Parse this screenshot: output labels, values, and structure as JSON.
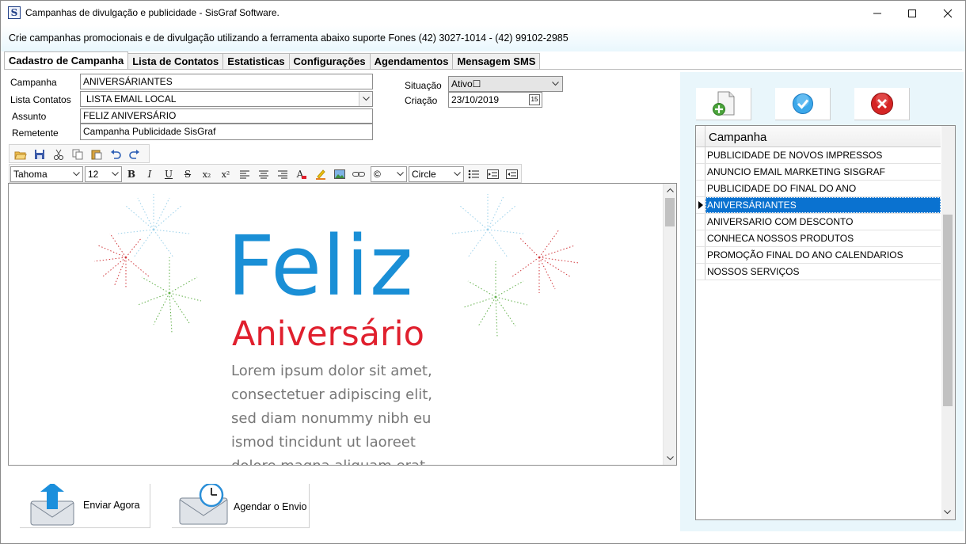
{
  "window": {
    "title": "Campanhas de divulgação e publicidade - SisGraf Software.",
    "icon_letter": "S",
    "controls": [
      "minimize-icon",
      "maximize-icon",
      "close-icon"
    ]
  },
  "banner": {
    "text": "Crie campanhas promocionais e de divulgação utilizando  a ferramenta abaixo  suporte  Fones  (42) 3027-1014 -  (42) 99102-2985"
  },
  "tabs": [
    {
      "label": "Cadastro de Campanha",
      "active": true
    },
    {
      "label": "Lista de Contatos",
      "active": false
    },
    {
      "label": "Estatisticas",
      "active": false
    },
    {
      "label": "Configurações",
      "active": false
    },
    {
      "label": "Agendamentos",
      "active": false
    },
    {
      "label": "Mensagem SMS",
      "active": false
    }
  ],
  "form": {
    "campanha_label": "Campanha",
    "campanha_value": "ANIVERSÁRIANTES",
    "lista_label": "Lista Contatos",
    "lista_value": "LISTA EMAIL LOCAL",
    "assunto_label": "Assunto",
    "assunto_value": "FELIZ ANIVERSÁRIO",
    "remetente_label": "Remetente",
    "remetente_value": "Campanha Publicidade SisGraf",
    "situacao_label": "Situação",
    "situacao_value": "Ativo☐",
    "criacao_label": "Criação",
    "criacao_value": "23/10/2019"
  },
  "editor_toolbar": {
    "font": "Tahoma",
    "size": "12",
    "symbol": "©",
    "list_style": "Circle",
    "icons": [
      "open-icon",
      "save-icon",
      "cut-icon",
      "copy-icon",
      "paste-icon",
      "undo-icon",
      "redo-icon",
      "bold-icon",
      "italic-icon",
      "underline-icon",
      "strikethrough-icon",
      "subscript-icon",
      "superscript-icon",
      "align-left-icon",
      "align-center-icon",
      "align-right-icon",
      "text-color-icon",
      "highlight-icon",
      "image-icon",
      "link-icon",
      "bullet-list-icon",
      "indent-icon",
      "outdent-icon"
    ],
    "labels": {
      "bold": "B",
      "italic": "I",
      "underline": "U",
      "strike": "S",
      "subscript": "x₂",
      "superscript": "x²",
      "text_color": "A"
    }
  },
  "editor_content": {
    "headline": "Feliz",
    "subheadline": "Aniversário",
    "body_lines": [
      "Lorem ipsum dolor sit amet,",
      "consectetuer adipiscing elit,",
      "sed diam nonummy nibh eu",
      "ismod tincidunt ut laoreet",
      "dolore magna aliquam erat"
    ]
  },
  "bottom_buttons": {
    "send_now": "Enviar Agora",
    "schedule": "Agendar o Envio"
  },
  "campaign_grid": {
    "header": "Campanha",
    "rows": [
      "PUBLICIDADE DE NOVOS IMPRESSOS",
      "ANUNCIO EMAIL MARKETING SISGRAF",
      "PUBLICIDADE DO FINAL DO ANO",
      "ANIVERSÁRIANTES",
      "ANIVERSARIO COM DESCONTO",
      "CONHECA NOSSOS PRODUTOS",
      "PROMOÇÃO FINAL DO ANO CALENDARIOS",
      "NOSSOS SERVIÇOS"
    ],
    "selected_index": 3
  },
  "colors": {
    "accent_blue": "#1a8fd6",
    "accent_red": "#e0202e",
    "selection": "#0a72d0",
    "panel_bg": "#e9f6fb"
  }
}
